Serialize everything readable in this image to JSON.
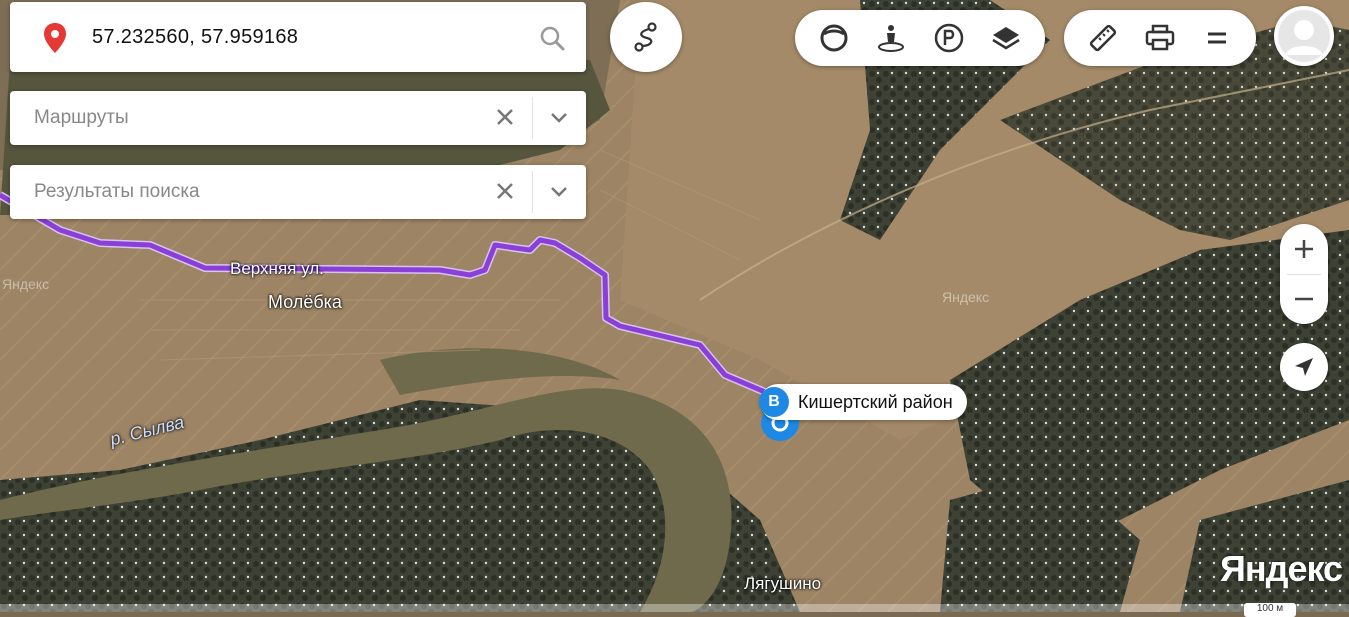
{
  "search": {
    "query": "57.232560, 57.959168"
  },
  "dropdowns": [
    {
      "label": "Маршруты"
    },
    {
      "label": "Результаты поиска"
    }
  ],
  "map_labels": {
    "street": "Верхняя ул.",
    "village": "Молёбка",
    "river": "р. Сылва",
    "village2": "Лягушино"
  },
  "watermarks": [
    "Яндекс",
    "Яндекс"
  ],
  "poi": {
    "marker_letter": "B",
    "label": "Кишертский район"
  },
  "brand": "Яндекс",
  "scale": "100 м",
  "colors": {
    "route": "#8a3fd6",
    "marker": "#1e88e5",
    "pin": "#e53935"
  },
  "toolbar_icons": [
    "routes-icon",
    "panorama-icon",
    "street-view-icon",
    "parking-icon",
    "layers-icon",
    "ruler-icon",
    "print-icon",
    "menu-icon",
    "user-avatar"
  ],
  "zoom_icons": [
    "zoom-in-icon",
    "zoom-out-icon",
    "geolocation-icon"
  ]
}
